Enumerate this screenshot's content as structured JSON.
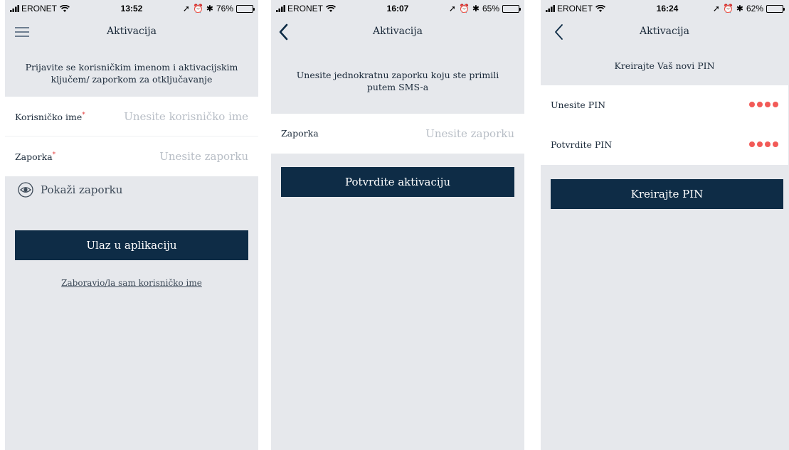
{
  "screens": [
    {
      "status": {
        "carrier": "ERONET",
        "time": "13:52",
        "battery": "76%",
        "battery_level": 0.76
      },
      "nav_title": "Aktivacija",
      "instruction": "Prijavite se korisničkim imenom i aktivacijskim ključem/ zaporkom za otključavanje",
      "fields": [
        {
          "label": "Korisničko ime",
          "required_mark": "*",
          "placeholder": "Unesite korisničko ime"
        },
        {
          "label": "Zaporka",
          "required_mark": "*",
          "placeholder": "Unesite zaporku"
        }
      ],
      "show_password_label": "Pokaži zaporku",
      "button_label": "Ulaz u aplikaciju",
      "forgot_link": "Zaboravio/la sam korisničko ime"
    },
    {
      "status": {
        "carrier": "ERONET",
        "time": "16:07",
        "battery": "65%",
        "battery_level": 0.65
      },
      "nav_title": "Aktivacija",
      "instruction": "Unesite jednokratnu zaporku koju ste primili putem SMS-a",
      "fields": [
        {
          "label": "Zaporka",
          "placeholder": "Unesite zaporku"
        }
      ],
      "button_label": "Potvrdite aktivaciju"
    },
    {
      "status": {
        "carrier": "ERONET",
        "time": "16:24",
        "battery": "62%",
        "battery_level": 0.62
      },
      "nav_title": "Aktivacija",
      "instruction": "Kreirajte Vaš novi PIN",
      "fields": [
        {
          "label": "Unesite PIN",
          "pin_digits_entered": 4
        },
        {
          "label": "Potvrdite PIN",
          "pin_digits_entered": 4
        }
      ],
      "button_label": "Kreirajte PIN"
    }
  ],
  "colors": {
    "primary_button": "#0e2c46",
    "background": "#e6e8ec",
    "pin_dot": "#f25a57",
    "required_mark": "#e53e3e"
  }
}
